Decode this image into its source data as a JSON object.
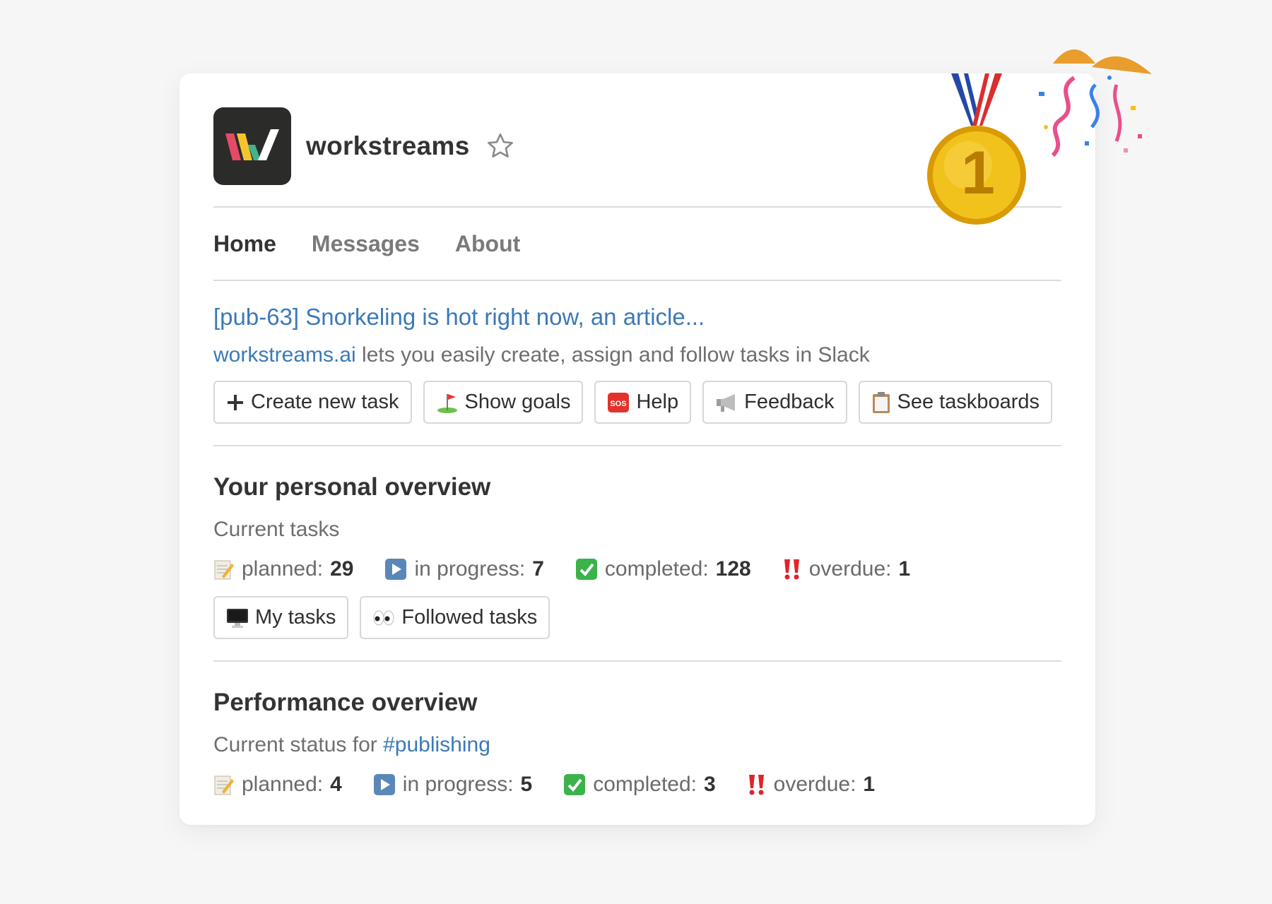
{
  "app": {
    "name": "workstreams"
  },
  "tabs": [
    {
      "label": "Home",
      "active": true
    },
    {
      "label": "Messages",
      "active": false
    },
    {
      "label": "About",
      "active": false
    }
  ],
  "article": {
    "title": "[pub-63] Snorkeling is hot right now, an article...",
    "desc_link": "workstreams.ai",
    "desc_text": " lets you easily create, assign and follow tasks in Slack"
  },
  "buttons": [
    {
      "label": "Create new task",
      "icon": "plus-icon"
    },
    {
      "label": "Show goals",
      "icon": "golf-flag-icon"
    },
    {
      "label": "Help",
      "icon": "sos-icon"
    },
    {
      "label": "Feedback",
      "icon": "megaphone-icon"
    },
    {
      "label": "See taskboards",
      "icon": "clipboard-icon"
    }
  ],
  "personal": {
    "title": "Your personal overview",
    "subtitle": "Current tasks",
    "stats": [
      {
        "label": "planned:",
        "value": "29",
        "icon": "memo-icon"
      },
      {
        "label": "in progress:",
        "value": "7",
        "icon": "play-icon"
      },
      {
        "label": "completed:",
        "value": "128",
        "icon": "check-icon"
      },
      {
        "label": "overdue:",
        "value": "1",
        "icon": "double-exclamation-icon"
      }
    ],
    "buttons": [
      {
        "label": "My tasks",
        "icon": "computer-icon"
      },
      {
        "label": "Followed tasks",
        "icon": "eyes-icon"
      }
    ]
  },
  "performance": {
    "title": "Performance overview",
    "subtitle_prefix": "Current status for ",
    "channel": "#publishing",
    "stats": [
      {
        "label": "planned:",
        "value": "4",
        "icon": "memo-icon"
      },
      {
        "label": "in progress:",
        "value": "5",
        "icon": "play-icon"
      },
      {
        "label": "completed:",
        "value": "3",
        "icon": "check-icon"
      },
      {
        "label": "overdue:",
        "value": "1",
        "icon": "double-exclamation-icon"
      }
    ]
  },
  "decor": {
    "medal_digit": "1"
  },
  "colors": {
    "link": "#3b79b6",
    "card": "#ffffff",
    "background": "#f6f6f6",
    "logo_bg": "#2b2c2a",
    "check": "#3cb24a",
    "overdue": "#e0242a"
  }
}
